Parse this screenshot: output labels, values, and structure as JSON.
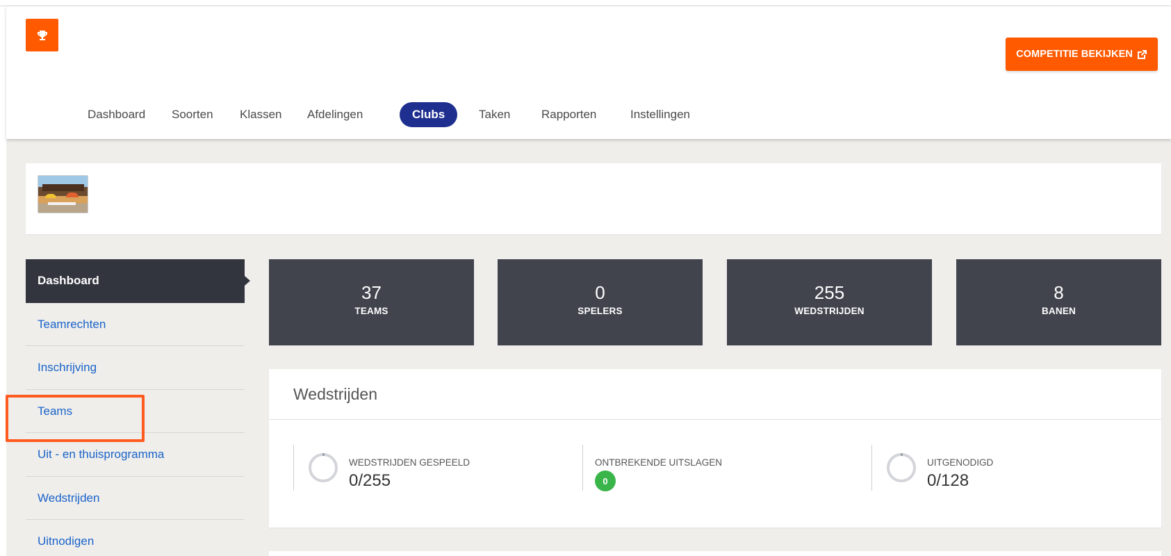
{
  "header": {
    "logo_icon": "trophy-icon",
    "cta_label": "COMPETITIE BEKIJKEN",
    "cta_icon": "external-link-icon",
    "accent_color": "#ff5a00"
  },
  "nav": {
    "items": [
      {
        "label": "Dashboard",
        "active": false
      },
      {
        "label": "Soorten",
        "active": false
      },
      {
        "label": "Klassen",
        "active": false
      },
      {
        "label": "Afdelingen",
        "active": false
      },
      {
        "label": "Clubs",
        "active": true
      },
      {
        "label": "Taken",
        "active": false
      },
      {
        "label": "Rapporten",
        "active": false
      },
      {
        "label": "Instellingen",
        "active": false
      }
    ],
    "active_color": "#1f2f8f"
  },
  "sidebar": {
    "items": [
      {
        "label": "Dashboard",
        "active": true
      },
      {
        "label": "Teamrechten",
        "active": false
      },
      {
        "label": "Inschrijving",
        "active": false
      },
      {
        "label": "Teams",
        "active": false,
        "highlighted": true
      },
      {
        "label": "Uit - en thuisprogramma",
        "active": false
      },
      {
        "label": "Wedstrijden",
        "active": false
      },
      {
        "label": "Uitnodigen",
        "active": false
      }
    ]
  },
  "stats": [
    {
      "value": "37",
      "label": "TEAMS"
    },
    {
      "value": "0",
      "label": "SPELERS"
    },
    {
      "value": "255",
      "label": "WEDSTRIJDEN"
    },
    {
      "value": "8",
      "label": "BANEN"
    }
  ],
  "panel": {
    "title": "Wedstrijden",
    "metrics": [
      {
        "label": "WEDSTRIJDEN GESPEELD",
        "value": "0/255",
        "progress": 0
      },
      {
        "label": "ONTBREKENDE UITSLAGEN",
        "badge": "0",
        "badge_color": "#39b54a"
      },
      {
        "label": "UITGENODIGD",
        "value": "0/128",
        "progress": 0
      }
    ]
  }
}
